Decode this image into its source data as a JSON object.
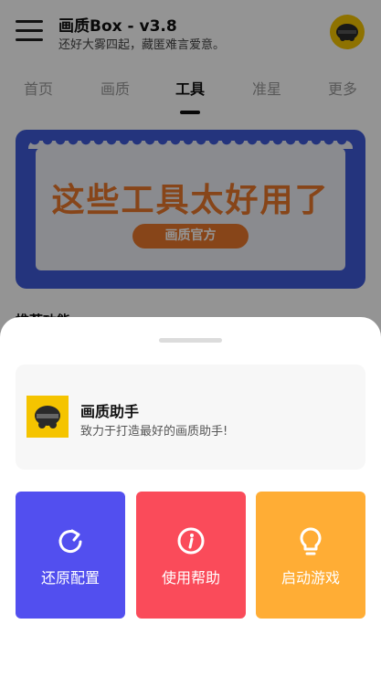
{
  "header": {
    "title": "画质Box - v3.8",
    "subtitle": "还好大雾四起，藏匿难言爱意。"
  },
  "tabs": [
    {
      "label": "首页"
    },
    {
      "label": "画质"
    },
    {
      "label": "工具"
    },
    {
      "label": "准星"
    },
    {
      "label": "更多"
    }
  ],
  "active_tab": "工具",
  "banner": {
    "headline": "这些工具太好用了",
    "tag": "画质官方"
  },
  "section": {
    "title": "推荐功能"
  },
  "sheet": {
    "app_name": "画质助手",
    "app_desc": "致力于打造最好的画质助手!",
    "actions": [
      {
        "label": "还原配置",
        "icon": "refresh-icon",
        "color": "#524fef"
      },
      {
        "label": "使用帮助",
        "icon": "info-icon",
        "color": "#fa4b5a"
      },
      {
        "label": "启动游戏",
        "icon": "lightbulb-icon",
        "color": "#ffad35"
      }
    ]
  },
  "colors": {
    "scrim": "rgba(0,0,0,0.42)",
    "banner_blue": "#3e5ad8",
    "banner_orange": "#e9782b",
    "logo_yellow": "#f5c400"
  }
}
